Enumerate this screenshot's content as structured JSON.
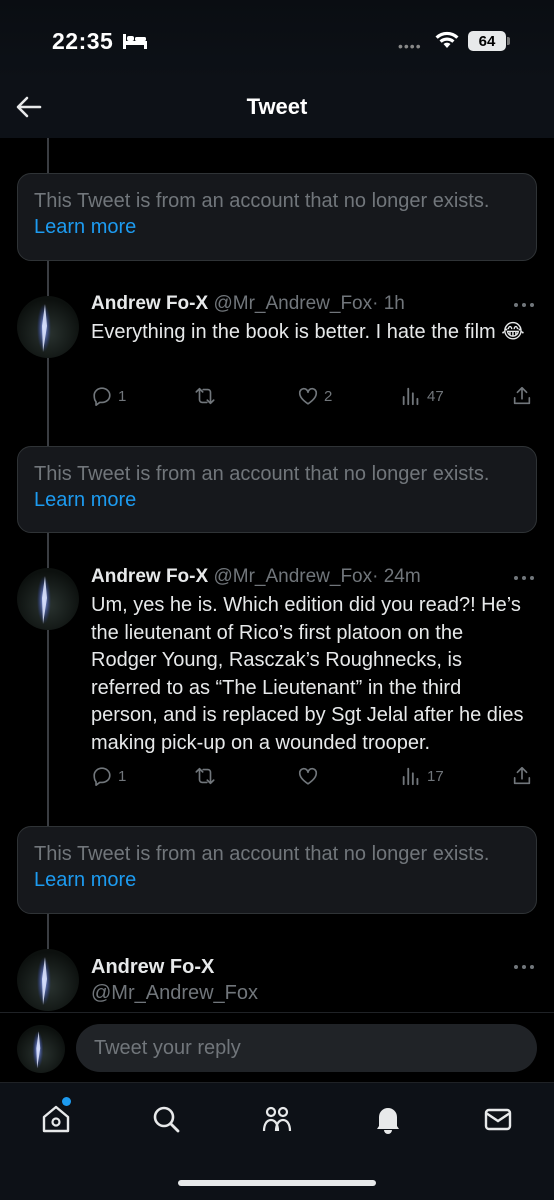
{
  "status_bar": {
    "time": "22:35",
    "battery": "64"
  },
  "header": {
    "title": "Tweet"
  },
  "notices": [
    {
      "text": "This Tweet is from an account that no longer exists.",
      "link": "Learn more"
    },
    {
      "text": "This Tweet is from an account that no longer exists.",
      "link": "Learn more"
    },
    {
      "text": "This Tweet is from an account that no longer exists.",
      "link": "Learn more"
    }
  ],
  "tweets": [
    {
      "name": "Andrew Fo-X",
      "handle": "@Mr_Andrew_Fox",
      "time": "· 1h",
      "text": "Everything in the book is better. I hate the film 😂",
      "replies": "1",
      "retweets": "",
      "likes": "2",
      "views": "47"
    },
    {
      "name": "Andrew Fo-X",
      "handle": "@Mr_Andrew_Fox",
      "time": "· 24m",
      "text": "Um, yes he is. Which edition did you read?! He’s the lieutenant of Rico’s first platoon on the Rodger Young, Rasczak’s Roughnecks, is referred to as “The Lieutenant” in the third person, and is replaced by Sgt Jelal after he dies making pick-up on a wounded trooper.",
      "replies": "1",
      "retweets": "",
      "likes": "",
      "views": "17"
    },
    {
      "name": "Andrew Fo-X",
      "handle": "@Mr_Andrew_Fox"
    }
  ],
  "reply_bar": {
    "placeholder": "Tweet your reply"
  },
  "nav": {
    "items": [
      "home-icon",
      "search-icon",
      "communities-icon",
      "notifications-icon",
      "messages-icon"
    ]
  },
  "colors": {
    "accent": "#1d9bf0",
    "muted": "#71767b",
    "background": "#000000"
  }
}
